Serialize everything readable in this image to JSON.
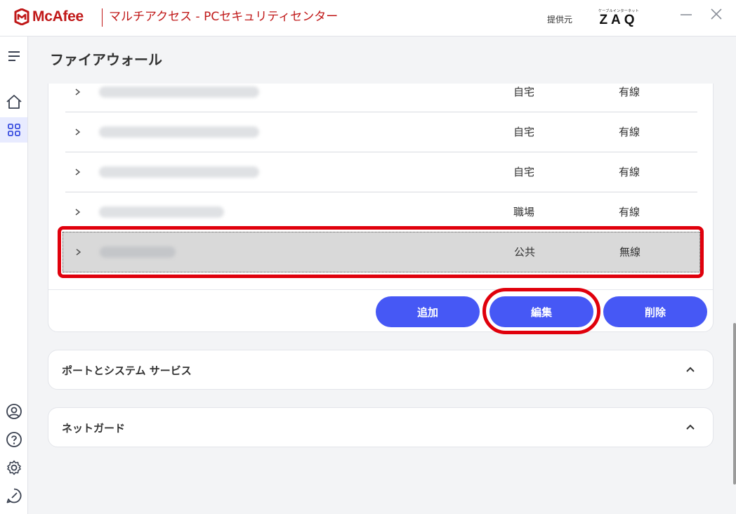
{
  "window": {
    "brand": "McAfee",
    "title": "マルチアクセス - PCセキュリティセンター",
    "provider_label": "提供元",
    "provider_logo_small": "ケーブルインターネット",
    "provider_logo_big": "ZAQ"
  },
  "page": {
    "title": "ファイアウォール"
  },
  "networks": [
    {
      "type": "自宅",
      "connection": "有線"
    },
    {
      "type": "自宅",
      "connection": "有線"
    },
    {
      "type": "自宅",
      "connection": "有線"
    },
    {
      "type": "職場",
      "connection": "有線"
    },
    {
      "type": "公共",
      "connection": "無線",
      "selected": true
    }
  ],
  "buttons": {
    "add": "追加",
    "edit": "編集",
    "delete": "削除"
  },
  "sections": [
    {
      "title": "ポートとシステム サービス"
    },
    {
      "title": "ネットガード"
    }
  ],
  "colors": {
    "brand_red": "#c01818",
    "accent_blue": "#4658f5",
    "highlight_red": "#e0000c"
  }
}
